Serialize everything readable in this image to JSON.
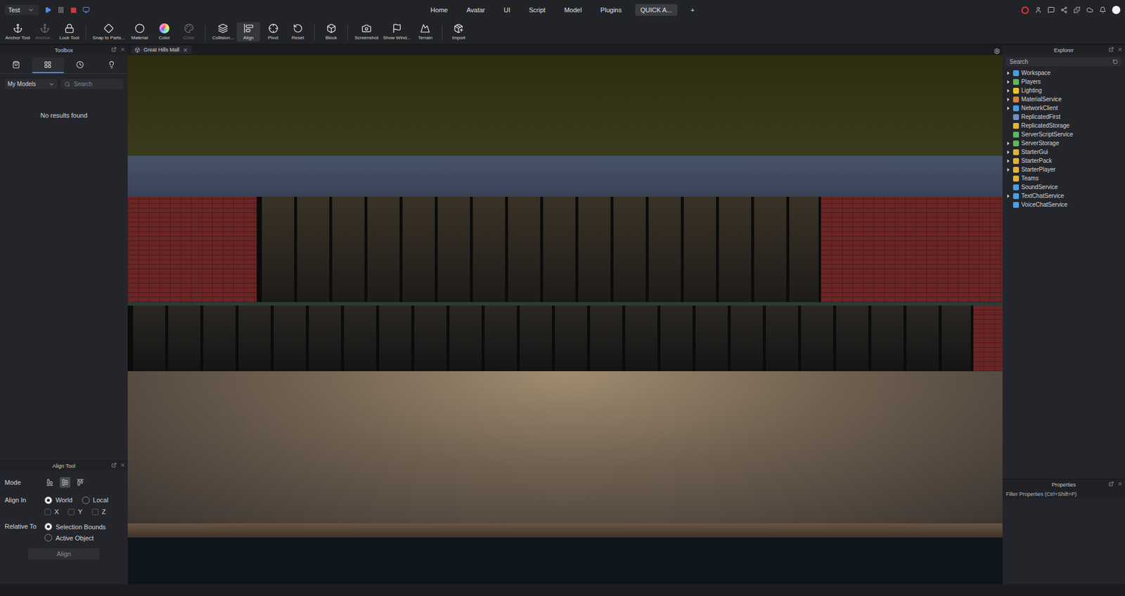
{
  "place_selector": {
    "label": "Test"
  },
  "menu_tabs": [
    {
      "label": "Home",
      "selected": false
    },
    {
      "label": "Avatar",
      "selected": false
    },
    {
      "label": "UI",
      "selected": false
    },
    {
      "label": "Script",
      "selected": false
    },
    {
      "label": "Model",
      "selected": false
    },
    {
      "label": "Plugins",
      "selected": false
    },
    {
      "label": "QUICK A...",
      "selected": true
    }
  ],
  "add_tab": "+",
  "ribbon_tools": [
    {
      "label": "Anchor Tool",
      "disabled": false,
      "selected": false
    },
    {
      "label": "Anchor...",
      "disabled": true,
      "selected": false
    },
    {
      "label": "Lock Tool",
      "disabled": false,
      "selected": false
    },
    {
      "label": "Snap to Parts...",
      "disabled": false,
      "selected": false
    },
    {
      "label": "Material",
      "disabled": false,
      "selected": false
    },
    {
      "label": "Color",
      "disabled": false,
      "selected": false
    },
    {
      "label": "Color",
      "disabled": true,
      "selected": false
    },
    {
      "label": "Collision...",
      "disabled": false,
      "selected": false
    },
    {
      "label": "Align",
      "disabled": false,
      "selected": true
    },
    {
      "label": "Pivot",
      "disabled": false,
      "selected": false
    },
    {
      "label": "Reset",
      "disabled": false,
      "selected": false
    },
    {
      "label": "Block",
      "disabled": false,
      "selected": false
    },
    {
      "label": "Screenshot",
      "disabled": false,
      "selected": false
    },
    {
      "label": "Show Wind...",
      "disabled": false,
      "selected": false
    },
    {
      "label": "Terrain",
      "disabled": false,
      "selected": false
    },
    {
      "label": "Import",
      "disabled": false,
      "selected": false
    }
  ],
  "toolbox": {
    "title": "Toolbox",
    "tabs": [
      {
        "selected": false
      },
      {
        "selected": true
      },
      {
        "selected": false
      },
      {
        "selected": false
      }
    ],
    "category": "My Models",
    "search_placeholder": "Search",
    "empty_message": "No results found"
  },
  "align_tool": {
    "title": "Align Tool",
    "mode_label": "Mode",
    "modes": [
      {
        "selected": false
      },
      {
        "selected": true
      },
      {
        "selected": false
      }
    ],
    "align_in_label": "Align In",
    "spaces": [
      {
        "label": "World",
        "selected": true
      },
      {
        "label": "Local",
        "selected": false
      }
    ],
    "axes": [
      {
        "label": "X",
        "checked": false
      },
      {
        "label": "Y",
        "checked": false
      },
      {
        "label": "Z",
        "checked": false
      }
    ],
    "relative_to_label": "Relative To",
    "relative_options": [
      {
        "label": "Selection Bounds",
        "selected": true
      },
      {
        "label": "Active Object",
        "selected": false
      }
    ],
    "button": "Align"
  },
  "document_tab": {
    "label": "Great Hills Mall"
  },
  "explorer": {
    "title": "Explorer",
    "search_placeholder": "Search",
    "items": [
      {
        "label": "Workspace",
        "expandable": true,
        "color": "#4a9fe0"
      },
      {
        "label": "Players",
        "expandable": true,
        "color": "#5cb85c"
      },
      {
        "label": "Lighting",
        "expandable": true,
        "color": "#f0c419"
      },
      {
        "label": "MaterialService",
        "expandable": true,
        "color": "#d9823b"
      },
      {
        "label": "NetworkClient",
        "expandable": true,
        "color": "#4a9fe0"
      },
      {
        "label": "ReplicatedFirst",
        "expandable": false,
        "color": "#6d8fc4"
      },
      {
        "label": "ReplicatedStorage",
        "expandable": false,
        "color": "#e0b43a"
      },
      {
        "label": "ServerScriptService",
        "expandable": false,
        "color": "#5cb85c"
      },
      {
        "label": "ServerStorage",
        "expandable": true,
        "color": "#5cb85c"
      },
      {
        "label": "StarterGui",
        "expandable": true,
        "color": "#e0b43a"
      },
      {
        "label": "StarterPack",
        "expandable": true,
        "color": "#e0b43a"
      },
      {
        "label": "StarterPlayer",
        "expandable": true,
        "color": "#e0b43a"
      },
      {
        "label": "Teams",
        "expandable": false,
        "color": "#e0b43a"
      },
      {
        "label": "SoundService",
        "expandable": false,
        "color": "#4a9fe0"
      },
      {
        "label": "TextChatService",
        "expandable": true,
        "color": "#4a9fe0"
      },
      {
        "label": "VoiceChatService",
        "expandable": false,
        "color": "#4a9fe0"
      }
    ]
  },
  "properties": {
    "title": "Properties",
    "filter_placeholder": "Filter Properties (Ctrl+Shift+P)"
  }
}
